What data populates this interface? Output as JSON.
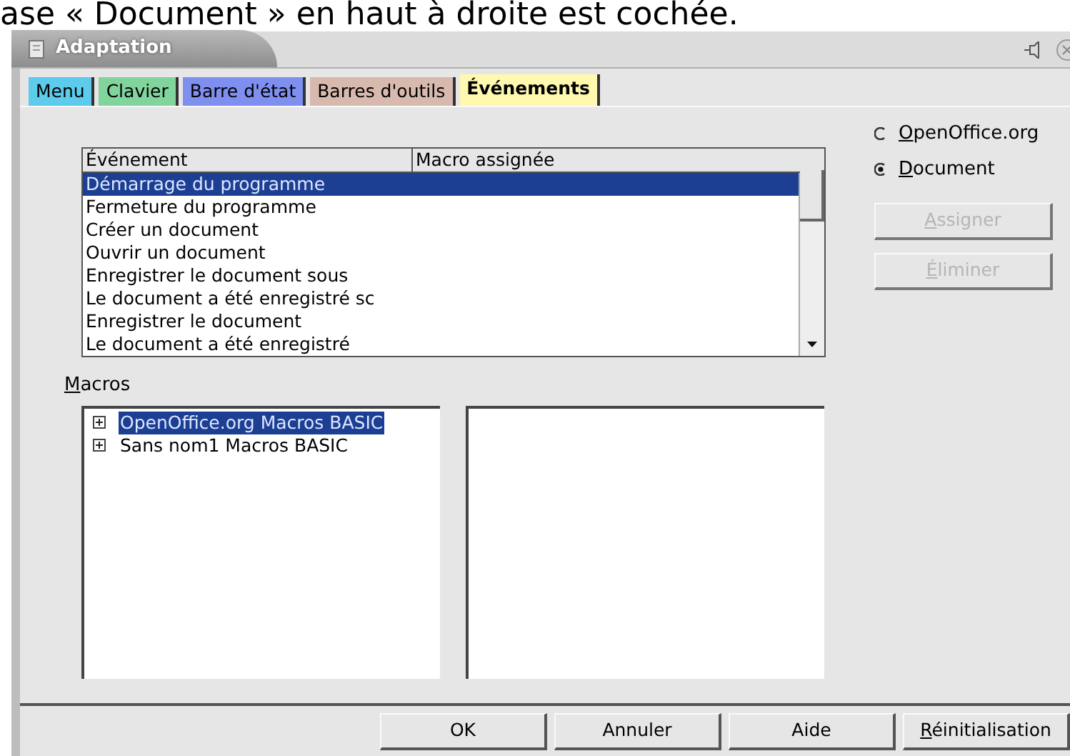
{
  "caption": "ase « Document » en haut à droite est cochée.",
  "window": {
    "title": "Adaptation"
  },
  "tabs": [
    {
      "label": "Menu",
      "color": "#5ccbec",
      "selected": false
    },
    {
      "label": "Clavier",
      "color": "#80d49c",
      "selected": false
    },
    {
      "label": "Barre d'état",
      "color": "#7f8ff0",
      "selected": false
    },
    {
      "label": "Barres d'outils",
      "color": "#d8b9ae",
      "selected": false
    },
    {
      "label": "Événements",
      "color": "#fff9b0",
      "selected": true
    }
  ],
  "events_table": {
    "columns": [
      "Événement",
      "Macro assignée"
    ],
    "rows": [
      {
        "event": "Démarrage du programme",
        "selected": true
      },
      {
        "event": "Fermeture du programme",
        "selected": false
      },
      {
        "event": "Créer un document",
        "selected": false
      },
      {
        "event": "Ouvrir un document",
        "selected": false
      },
      {
        "event": "Enregistrer le document sous",
        "selected": false
      },
      {
        "event": "Le document a été enregistré sc",
        "selected": false
      },
      {
        "event": "Enregistrer le document",
        "selected": false
      },
      {
        "event": "Le document a été enregistré",
        "selected": false
      }
    ]
  },
  "save_in": [
    {
      "label": "OpenOffice.org",
      "selected": false
    },
    {
      "label": "Document",
      "selected": true
    }
  ],
  "side_buttons": [
    {
      "label": "Assigner",
      "disabled": true
    },
    {
      "label": "Éliminer",
      "disabled": true
    }
  ],
  "macros": {
    "label": "Macros",
    "tree": [
      {
        "label": "OpenOffice.org Macros BASIC",
        "expanded": false,
        "selected": true
      },
      {
        "label": "Sans nom1 Macros BASIC",
        "expanded": false,
        "selected": false
      }
    ]
  },
  "footer_buttons": [
    {
      "label": "OK",
      "mnemonic": false
    },
    {
      "label": "Annuler",
      "mnemonic": false
    },
    {
      "label": "Aide",
      "mnemonic": false
    },
    {
      "label": "Réinitialisation",
      "mnemonic": true
    }
  ]
}
